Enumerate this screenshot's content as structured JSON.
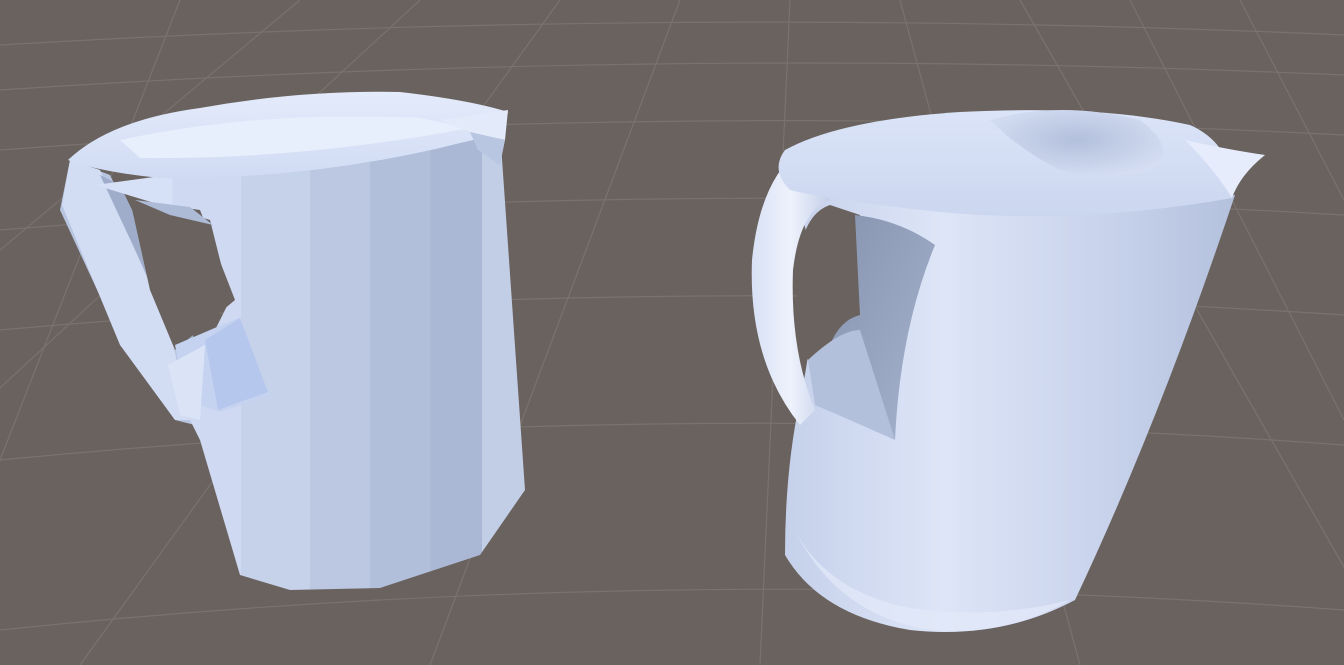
{
  "scene": {
    "background_color": "#6a625e",
    "grid_color": "#7c7470",
    "objects": [
      {
        "name": "low-poly-pitcher",
        "shading": "flat-faceted",
        "color": "#c9d6ef"
      },
      {
        "name": "smooth-pitcher",
        "shading": "smooth",
        "color": "#d3ddf2"
      }
    ]
  }
}
